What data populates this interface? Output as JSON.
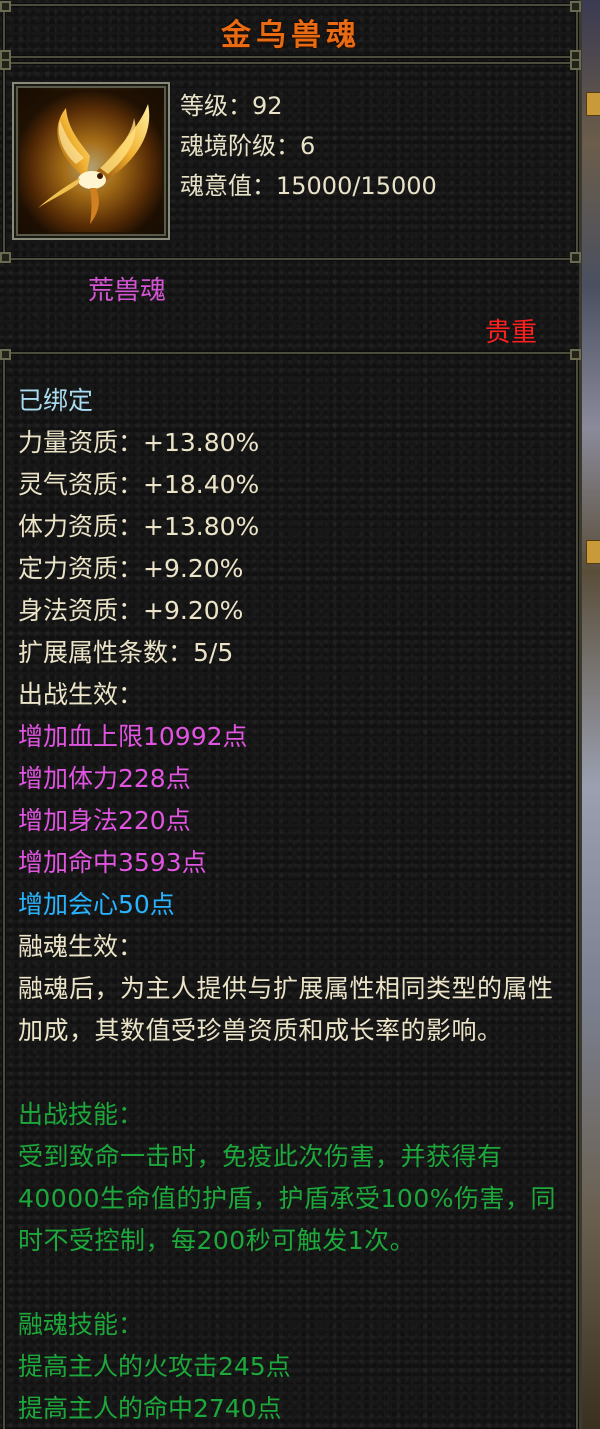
{
  "title": "金乌兽魂",
  "stats": [
    {
      "label": "等级：",
      "value": "92"
    },
    {
      "label": "魂境阶级：",
      "value": "6"
    },
    {
      "label": "魂意值：",
      "value": "15000/15000"
    }
  ],
  "soul_type": "荒兽魂",
  "rarity": "贵重",
  "bound": "已绑定",
  "aptitudes": [
    {
      "label": "力量资质：",
      "value": "+13.80%"
    },
    {
      "label": "灵气资质：",
      "value": "+18.40%"
    },
    {
      "label": "体力资质：",
      "value": "+13.80%"
    },
    {
      "label": "定力资质：",
      "value": "+9.20%"
    },
    {
      "label": "身法资质：",
      "value": "+9.20%"
    },
    {
      "label": "扩展属性条数：",
      "value": "5/5"
    }
  ],
  "battle_effect_header": "出战生效：",
  "battle_effects": [
    {
      "text": "增加血上限10992点",
      "color": "purple"
    },
    {
      "text": "增加体力228点",
      "color": "purple"
    },
    {
      "text": "增加身法220点",
      "color": "purple"
    },
    {
      "text": "增加命中3593点",
      "color": "purple"
    },
    {
      "text": "增加会心50点",
      "color": "blue"
    }
  ],
  "fusion_effect_header": "融魂生效：",
  "fusion_effect_desc": "融魂后，为主人提供与扩展属性相同类型的属性加成，其数值受珍兽资质和成长率的影响。",
  "battle_skill_header": "出战技能：",
  "battle_skill_desc": "受到致命一击时，免疫此次伤害，并获得有40000生命值的护盾，护盾承受100%伤害，同时不受控制，每200秒可触发1次。",
  "fusion_skill_header": "融魂技能：",
  "fusion_skills": [
    "提高主人的火攻击245点",
    "提高主人的命中2740点"
  ],
  "colors": {
    "title": "#e86a12",
    "purple": "#e054e0",
    "blue": "#28b4ff",
    "green": "#1ca83a",
    "rarity": "#ff2020",
    "bound": "#a8dcf0"
  }
}
